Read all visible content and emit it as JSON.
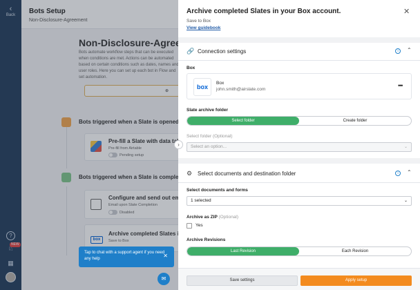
{
  "rail": {
    "back_label": "Back",
    "back_icon": "chevron-left-icon",
    "notification_badge": "NEW"
  },
  "background": {
    "title": "Bots Setup",
    "subtitle": "Non-Disclosure-Agreement",
    "heading": "Non-Disclosure-Agreement",
    "description": "Bots automate workflow steps that can be executed when conditions are met. Actions can be automated based on certain conditions such as dates, names and user roles. Here you can set up each bot in Flow and set automation.",
    "add_label": "Ad",
    "section1_label": "Bots triggered when a Slate is opened",
    "section2_label": "Bots triggered when a Slate is completed",
    "cards": [
      {
        "title": "Pre-fill a Slate with data taken",
        "sub": "Pre-fill from Airtable",
        "toggle_text": "Pending setup"
      },
      {
        "title": "Configure and send out email",
        "sub": "Email upon Slate Completion",
        "toggle_text": "Disabled"
      },
      {
        "title": "Archive completed Slates in yo",
        "sub": "Save to Box",
        "logo": "box"
      }
    ],
    "tooltip": "Tap to chat with a support agent if you need any help"
  },
  "panel": {
    "title": "Archive completed Slates in your Box account.",
    "subtitle": "Save to Box",
    "guidebook_link": "View guidebook",
    "connection": {
      "label": "Connection settings",
      "service_label": "Box",
      "account_logo": "box",
      "account_name": "Box",
      "account_email": "john.smith@airslate.com",
      "more": "•••"
    },
    "archive_folder": {
      "label": "Slate archive folder",
      "options": [
        "Select folder",
        "Create folder"
      ],
      "selected": "Select folder"
    },
    "select_folder": {
      "label": "Select folder",
      "optional": "(Optional)",
      "placeholder": "Select an option..."
    },
    "documents": {
      "label": "Select documents and destination folder",
      "forms_label": "Select documents and forms",
      "forms_value": "1 selected"
    },
    "zip": {
      "label": "Archive as ZIP",
      "optional": "(Optional)",
      "checkbox_label": "Yes"
    },
    "revisions": {
      "label": "Archive Revisions",
      "options": [
        "Last Revision",
        "Each Revision"
      ],
      "selected": "Last Revision"
    },
    "footer": {
      "save_label": "Save settings",
      "apply_label": "Apply setup"
    }
  },
  "colors": {
    "rail": "#233d5c",
    "accent_green": "#3fae69",
    "accent_orange": "#f38b1f",
    "link_blue": "#1f5aa6",
    "info_blue": "#1f7fc9"
  }
}
